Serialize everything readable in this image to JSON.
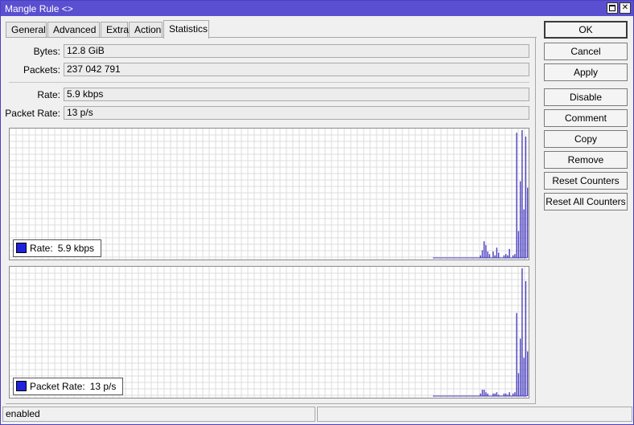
{
  "window": {
    "title": "Mangle Rule <>",
    "maximize_label": "",
    "close_label": "✕"
  },
  "tabs": [
    {
      "label": "General"
    },
    {
      "label": "Advanced"
    },
    {
      "label": "Extra"
    },
    {
      "label": "Action"
    },
    {
      "label": "Statistics",
      "active": true
    }
  ],
  "stats": {
    "bytes_label": "Bytes:",
    "bytes_value": "12.8 GiB",
    "packets_label": "Packets:",
    "packets_value": "237 042 791",
    "rate_label": "Rate:",
    "rate_value": "5.9 kbps",
    "packet_rate_label": "Packet Rate:",
    "packet_rate_value": "13 p/s"
  },
  "graphs": [
    {
      "legend_label": "Rate:",
      "legend_value": "5.9 kbps",
      "series_color": "#2020e0",
      "line_color": "#4a3fbf",
      "samples": [
        0,
        0,
        0,
        0,
        0,
        0,
        0,
        0,
        0,
        0,
        0,
        0,
        0,
        0,
        0,
        0,
        0,
        0,
        0,
        0,
        0,
        0,
        0,
        0,
        0,
        0,
        0.02,
        0.06,
        0.13,
        0.1,
        0.05,
        0.03,
        0,
        0.05,
        0.02,
        0.08,
        0.04,
        0,
        0,
        0.02,
        0.03,
        0.02,
        0.07,
        0,
        0.02,
        0.03,
        0.98,
        0.21,
        0.6,
        1.0,
        0.38,
        0.95,
        0.55
      ]
    },
    {
      "legend_label": "Packet Rate:",
      "legend_value": "13 p/s",
      "series_color": "#2020e0",
      "line_color": "#4a3fbf",
      "samples": [
        0,
        0,
        0,
        0,
        0,
        0,
        0,
        0,
        0,
        0,
        0,
        0,
        0,
        0,
        0,
        0,
        0,
        0,
        0,
        0,
        0,
        0,
        0,
        0,
        0,
        0,
        0.02,
        0.05,
        0.05,
        0.03,
        0.02,
        0,
        0,
        0.02,
        0.02,
        0.03,
        0.01,
        0,
        0,
        0.02,
        0.02,
        0.01,
        0.03,
        0,
        0.02,
        0.03,
        0.65,
        0.18,
        0.45,
        1.0,
        0.3,
        0.9,
        0.35
      ]
    }
  ],
  "buttons": {
    "ok": "OK",
    "cancel": "Cancel",
    "apply": "Apply",
    "disable": "Disable",
    "comment": "Comment",
    "copy": "Copy",
    "remove": "Remove",
    "reset_counters": "Reset Counters",
    "reset_all_counters": "Reset All Counters"
  },
  "statusbar": {
    "status": "enabled",
    "secondary": ""
  }
}
